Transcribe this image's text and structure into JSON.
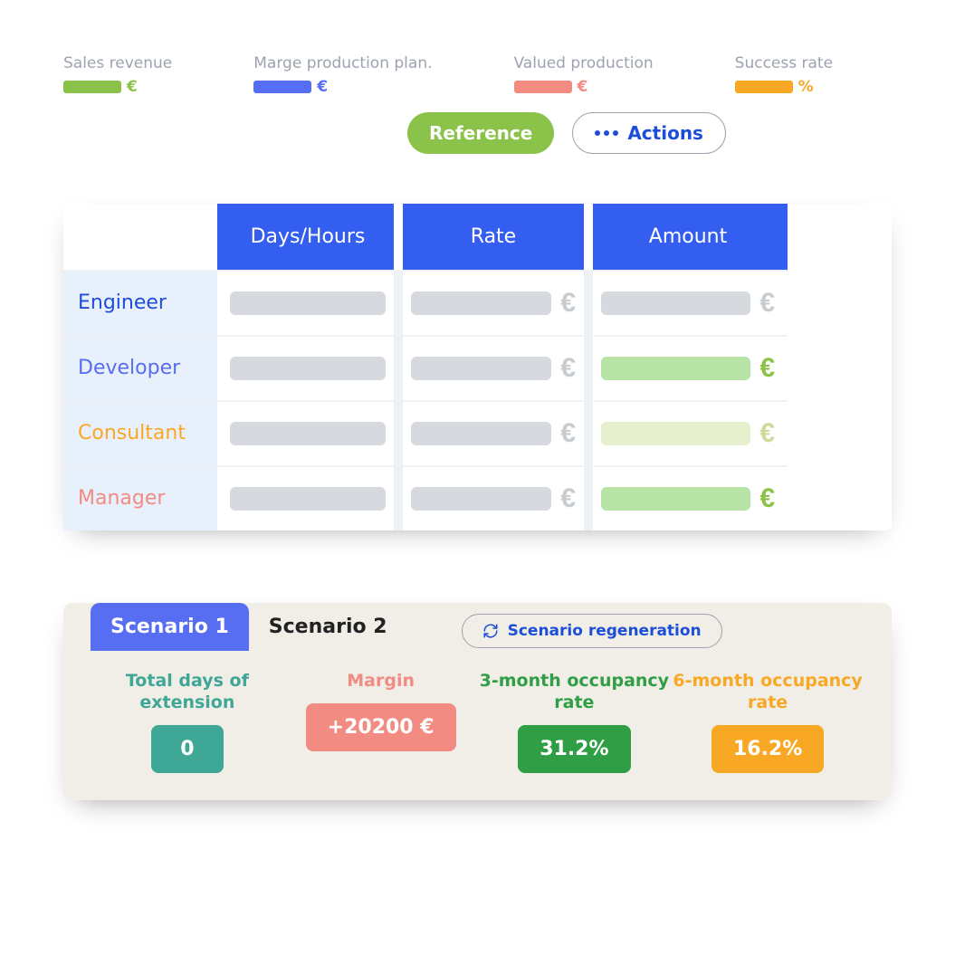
{
  "legend": {
    "sales": {
      "label": "Sales revenue",
      "unit": "€"
    },
    "margin": {
      "label": "Marge production plan.",
      "unit": "€"
    },
    "valued": {
      "label": "Valued production",
      "unit": "€"
    },
    "success": {
      "label": "Success rate",
      "unit": "%"
    }
  },
  "buttons": {
    "reference": "Reference",
    "actions": "Actions"
  },
  "table": {
    "headers": {
      "c1": "Days/Hours",
      "c2": "Rate",
      "c3": "Amount"
    },
    "rows": [
      {
        "role": "Engineer"
      },
      {
        "role": "Developer"
      },
      {
        "role": "Consultant"
      },
      {
        "role": "Manager"
      }
    ]
  },
  "scenario": {
    "tab1": "Scenario 1",
    "tab2": "Scenario 2",
    "regen": "Scenario regeneration",
    "metrics": {
      "ext": {
        "label": "Total days of extension",
        "value": "0"
      },
      "marg": {
        "label": "Margin",
        "value": "+20200  €"
      },
      "occ3": {
        "label": "3-month occupancy rate",
        "value": "31.2%"
      },
      "occ6": {
        "label": "6-month occupancy rate",
        "value": "16.2%"
      }
    }
  }
}
